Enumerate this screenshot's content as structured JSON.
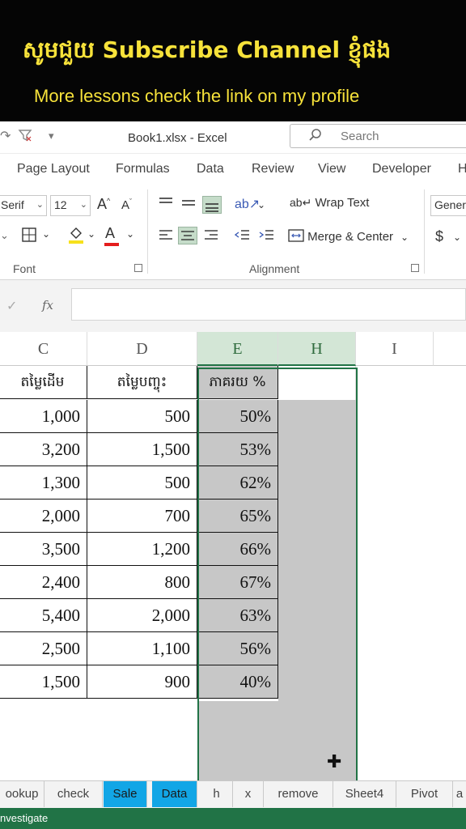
{
  "overlay": {
    "line1": "សូមជួយ Subscribe Channel ខ្ញុំផង",
    "line2": "More lessons check the link on my profile"
  },
  "titlebar": {
    "document_title": "Book1.xlsx  -  Excel",
    "search_placeholder": "Search"
  },
  "ribbon_tabs": [
    "Page Layout",
    "Formulas",
    "Data",
    "Review",
    "View",
    "Developer",
    "H"
  ],
  "font_group": {
    "font_name": "Serif",
    "font_size": "12",
    "grow_label": "A",
    "shrink_label": "A",
    "font_color_label": "A",
    "group_label": "Font"
  },
  "alignment_group": {
    "wrap_text_label": "Wrap Text",
    "merge_center_label": "Merge & Center",
    "group_label": "Alignment"
  },
  "number_group": {
    "format_value": "Genera",
    "currency_symbol": "$"
  },
  "formula_bar": {
    "fx_label": "fx",
    "value": ""
  },
  "grid": {
    "columns": [
      {
        "letter": "C"
      },
      {
        "letter": "D"
      },
      {
        "letter": "E"
      },
      {
        "letter": "H"
      },
      {
        "letter": "I"
      }
    ],
    "headers": [
      "តម្លៃដើម",
      "តម្លៃបញ្ចុះ",
      "ភាគរយ %"
    ],
    "rows": [
      [
        "1,000",
        "500",
        "50%"
      ],
      [
        "3,200",
        "1,500",
        "53%"
      ],
      [
        "1,300",
        "500",
        "62%"
      ],
      [
        "2,000",
        "700",
        "65%"
      ],
      [
        "3,500",
        "1,200",
        "66%"
      ],
      [
        "2,400",
        "800",
        "67%"
      ],
      [
        "5,400",
        "2,000",
        "63%"
      ],
      [
        "2,500",
        "1,100",
        "56%"
      ],
      [
        "1,500",
        "900",
        "40%"
      ]
    ]
  },
  "sheet_tabs": [
    "ookup",
    "check",
    "Sale",
    "Data",
    "h",
    "x",
    "remove",
    "Sheet4",
    "Pivot",
    "a"
  ],
  "highlighted_tabs": [
    "Sale",
    "Data"
  ],
  "status": {
    "text": "nvestigate"
  },
  "colors": {
    "banner_text": "#f7e23a",
    "excel_green": "#217346",
    "selected_fill": "#c7c7c7",
    "tab_highlight": "#12a6e6"
  }
}
